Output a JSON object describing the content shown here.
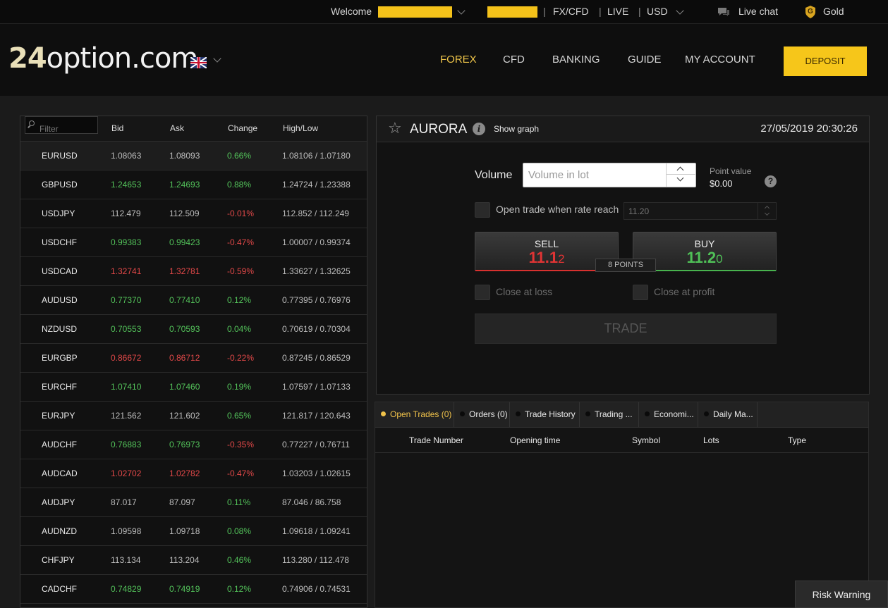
{
  "topbar": {
    "welcome": "Welcome",
    "account_type": "FX/CFD",
    "mode": "LIVE",
    "currency": "USD",
    "live_chat": "Live chat",
    "tier": "Gold",
    "tier_badge": "G"
  },
  "header": {
    "logo_num": "24",
    "logo_text": "option.com",
    "nav": [
      "FOREX",
      "CFD",
      "BANKING",
      "GUIDE",
      "MY ACCOUNT"
    ],
    "deposit": "DEPOSIT"
  },
  "quotes": {
    "filter_placeholder": "Filter",
    "columns": [
      "Bid",
      "Ask",
      "Change",
      "High/Low"
    ],
    "rows": [
      {
        "symbol": "EURUSD",
        "bid": "1.08063",
        "ask": "1.08093",
        "change": "0.66%",
        "highlow": "1.08106 / 1.07180",
        "dir": "flat",
        "chg": "up"
      },
      {
        "symbol": "GBPUSD",
        "bid": "1.24653",
        "ask": "1.24693",
        "change": "0.88%",
        "highlow": "1.24724 / 1.23388",
        "dir": "up",
        "chg": "up"
      },
      {
        "symbol": "USDJPY",
        "bid": "112.479",
        "ask": "112.509",
        "change": "-0.01%",
        "highlow": "112.852 / 112.249",
        "dir": "flat",
        "chg": "dn"
      },
      {
        "symbol": "USDCHF",
        "bid": "0.99383",
        "ask": "0.99423",
        "change": "-0.47%",
        "highlow": "1.00007 / 0.99374",
        "dir": "up",
        "chg": "dn"
      },
      {
        "symbol": "USDCAD",
        "bid": "1.32741",
        "ask": "1.32781",
        "change": "-0.59%",
        "highlow": "1.33627 / 1.32625",
        "dir": "dn",
        "chg": "dn"
      },
      {
        "symbol": "AUDUSD",
        "bid": "0.77370",
        "ask": "0.77410",
        "change": "0.12%",
        "highlow": "0.77395 / 0.76976",
        "dir": "up",
        "chg": "up"
      },
      {
        "symbol": "NZDUSD",
        "bid": "0.70553",
        "ask": "0.70593",
        "change": "0.04%",
        "highlow": "0.70619 / 0.70304",
        "dir": "up",
        "chg": "up"
      },
      {
        "symbol": "EURGBP",
        "bid": "0.86672",
        "ask": "0.86712",
        "change": "-0.22%",
        "highlow": "0.87245 / 0.86529",
        "dir": "dn",
        "chg": "dn"
      },
      {
        "symbol": "EURCHF",
        "bid": "1.07410",
        "ask": "1.07460",
        "change": "0.19%",
        "highlow": "1.07597 / 1.07133",
        "dir": "up",
        "chg": "up"
      },
      {
        "symbol": "EURJPY",
        "bid": "121.562",
        "ask": "121.602",
        "change": "0.65%",
        "highlow": "121.817 / 120.643",
        "dir": "flat",
        "chg": "up"
      },
      {
        "symbol": "AUDCHF",
        "bid": "0.76883",
        "ask": "0.76973",
        "change": "-0.35%",
        "highlow": "0.77227 / 0.76711",
        "dir": "up",
        "chg": "dn"
      },
      {
        "symbol": "AUDCAD",
        "bid": "1.02702",
        "ask": "1.02782",
        "change": "-0.47%",
        "highlow": "1.03203 / 1.02615",
        "dir": "dn",
        "chg": "dn"
      },
      {
        "symbol": "AUDJPY",
        "bid": "87.017",
        "ask": "87.097",
        "change": "0.11%",
        "highlow": "87.046 / 86.758",
        "dir": "flat",
        "chg": "up"
      },
      {
        "symbol": "AUDNZD",
        "bid": "1.09598",
        "ask": "1.09718",
        "change": "0.08%",
        "highlow": "1.09618 / 1.09241",
        "dir": "flat",
        "chg": "up"
      },
      {
        "symbol": "CHFJPY",
        "bid": "113.134",
        "ask": "113.204",
        "change": "0.46%",
        "highlow": "113.280 / 112.478",
        "dir": "flat",
        "chg": "up"
      },
      {
        "symbol": "CADCHF",
        "bid": "0.74829",
        "ask": "0.74919",
        "change": "0.12%",
        "highlow": "0.74906 / 0.74531",
        "dir": "up",
        "chg": "up"
      }
    ]
  },
  "instrument": {
    "title": "AURORA",
    "info_icon": "i",
    "show_graph": "Show graph",
    "datetime": "27/05/2019 20:30:26",
    "volume_label": "Volume",
    "volume_placeholder": "Volume in lot",
    "point_value_label": "Point value",
    "point_value": "$0.00",
    "help_icon": "?",
    "rate_label": "Open trade when rate reach",
    "rate_placeholder": "11.20",
    "sell_label": "SELL",
    "sell_price_main": "11.1",
    "sell_price_tail": "2",
    "buy_label": "BUY",
    "buy_price_main": "11.2",
    "buy_price_tail": "0",
    "spread": "8 POINTS",
    "close_loss": "Close at loss",
    "close_profit": "Close at profit",
    "trade_button": "TRADE"
  },
  "trades": {
    "tabs": [
      "Open Trades (0)",
      "Orders (0)",
      "Trade History",
      "Trading ...",
      "Economi...",
      "Daily Ma..."
    ],
    "columns": [
      "Trade Number",
      "Opening time",
      "Symbol",
      "Lots",
      "Type"
    ]
  },
  "risk_warning": "Risk Warning",
  "colors": {
    "accent": "#f6c61a",
    "up": "#53c25a",
    "down": "#e14848"
  }
}
